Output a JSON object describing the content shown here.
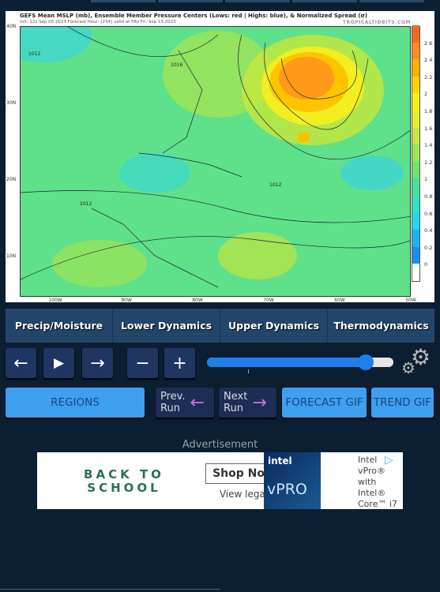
{
  "map": {
    "title": "GEFS Mean MSLP (mb), Ensemble Member Pressure Centers (Lows: red | Highs: blue), & Normalized Spread (σ)",
    "subtitle": "Init: 12z Sep 05 2023   Forecast Hour: [234]   valid at 06z Fri, Sep 15 2023",
    "brand": "TROPICALTIDBITS.COM",
    "lat_labels": [
      "40N",
      "30N",
      "20N",
      "10N"
    ],
    "lon_labels": [
      "100W",
      "90W",
      "80W",
      "70W",
      "60W",
      "50W"
    ],
    "isobar_labels": [
      "1012",
      "1016",
      "1012",
      "1012"
    ],
    "colorbar": {
      "ticks": [
        "0",
        "0.2",
        "0.4",
        "0.6",
        "0.8",
        "1",
        "1.2",
        "1.4",
        "1.6",
        "1.8",
        "2",
        "2.2",
        "2.4",
        "2.6"
      ],
      "colors": [
        "#ffffff",
        "#1e8ff0",
        "#1fb2f2",
        "#22d6ee",
        "#2fe2c4",
        "#45e29a",
        "#72e272",
        "#9ee452",
        "#c4e83e",
        "#e0ef2e",
        "#f4f01e",
        "#ffd400",
        "#ffb000",
        "#ff8d1e",
        "#f26a1e"
      ]
    }
  },
  "tabs": [
    "Precip/Moisture",
    "Lower Dynamics",
    "Upper Dynamics",
    "Thermodynamics"
  ],
  "controls": {
    "prev": "←",
    "play": "▶",
    "next": "→",
    "minus": "−",
    "plus": "+",
    "slider_fraction": 0.85
  },
  "buttons": {
    "regions": "REGIONS",
    "prev_run": [
      "Prev.",
      "Run"
    ],
    "next_run": [
      "Next",
      "Run"
    ],
    "forecast_gif": "FORECAST GIF",
    "trend_gif": "TREND GIF"
  },
  "ad": {
    "label": "Advertisement",
    "headline1": "BACK TO",
    "headline2": "SCHOOL",
    "cta": "Shop Now",
    "legal": "View legal",
    "brand": "intel",
    "product": "vPRO",
    "copy": [
      "Intel",
      "vPro®",
      "with",
      "Intel®",
      "Core™ i7"
    ]
  }
}
